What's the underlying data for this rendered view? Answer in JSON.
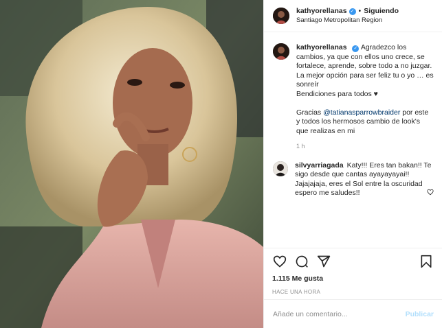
{
  "post": {
    "author": "kathyorellanas",
    "follow_status": "Siguiendo",
    "separator": "•",
    "location": "Santiago Metropolitan Region",
    "photo_icon": "portrait-photo"
  },
  "caption": {
    "author": "kathyorellanas",
    "lines": [
      "Agradezco los cambios, ya que con ellos uno crece, se fortalece, aprende, sobre todo a no juzgar.",
      "La mejor opción para ser feliz tu o yo … es sonreír",
      "Bendiciones para todos ♥"
    ],
    "thanks_prefix": "Gracias",
    "mention": "@tatianasparrowbraider",
    "thanks_suffix": "por este y todos los hermosos cambio de look's que realizas en mi",
    "time": "1 h"
  },
  "comment": {
    "author": "silvyarriagada",
    "text": "Katy!!! Eres tan bakan!! Te sigo desde que cantas ayayayayai!! Jajajajaja, eres el Sol entre la oscuridad espero me saludes!!",
    "like_icon": "heart-outline-icon"
  },
  "actions": {
    "icons": [
      "heart-icon",
      "comment-icon",
      "share-icon",
      "bookmark-icon"
    ],
    "likes": "1.115 Me gusta",
    "time": "HACE UNA HORA"
  },
  "add_comment": {
    "placeholder": "Añade un comentario...",
    "publish_label": "Publicar"
  },
  "colors": {
    "verified": "#3897f0",
    "link": "#00376b",
    "publish_disabled": "#b2dffc",
    "secondary_text": "#8e8e8e"
  }
}
